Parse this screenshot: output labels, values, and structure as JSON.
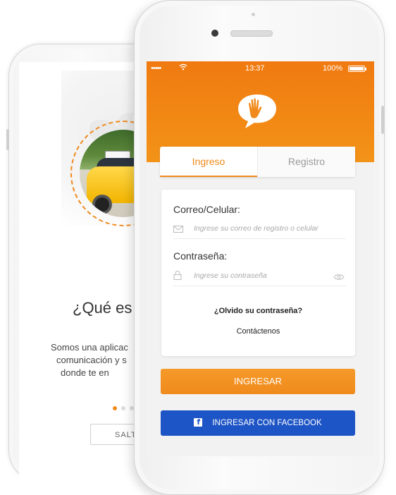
{
  "colors": {
    "accent": "#f08a1c",
    "facebook": "#1e55c6"
  },
  "back_screen": {
    "title": "¿Qué es",
    "description_lines": [
      "Somos una aplicac",
      "comunicación y s",
      "donde te en"
    ],
    "skip_label": "SALT",
    "pagination_active_index": 0
  },
  "front_screen": {
    "status": {
      "signal": "•••••",
      "wifi_icon": "wifi-icon",
      "time": "13:37",
      "battery": "100%"
    },
    "logo_icon": "hand-speech-bubble-icon",
    "tabs": [
      {
        "label": "Ingreso",
        "active": true
      },
      {
        "label": "Registro",
        "active": false
      }
    ],
    "form": {
      "email_label": "Correo/Celular:",
      "email_placeholder": "Ingrese su correo de registro o celular",
      "email_icon": "mail-icon",
      "password_label": "Contraseña:",
      "password_placeholder": "Ingrese su contraseña",
      "password_icon": "lock-icon",
      "show_password_icon": "eye-icon",
      "forgot_password_link": "¿Olvido su contraseña?",
      "contact_link": "Contáctenos"
    },
    "login_button": "INGRESAR",
    "facebook_button": "INGRESAR CON FACEBOOK",
    "facebook_icon": "facebook-icon"
  }
}
